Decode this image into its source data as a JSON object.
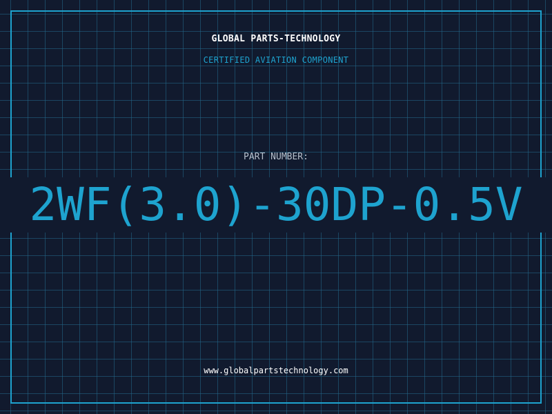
{
  "header": {
    "company": "GLOBAL PARTS-TECHNOLOGY",
    "tagline": "CERTIFIED AVIATION COMPONENT"
  },
  "part": {
    "label": "PART NUMBER:",
    "number": "2WF(3.0)-30DP-0.5V"
  },
  "footer": {
    "website": "www.globalpartstechnology.com"
  },
  "colors": {
    "background": "#111a2e",
    "accent": "#1ea3cf",
    "grid": "#23698c",
    "text": "#ffffff"
  }
}
